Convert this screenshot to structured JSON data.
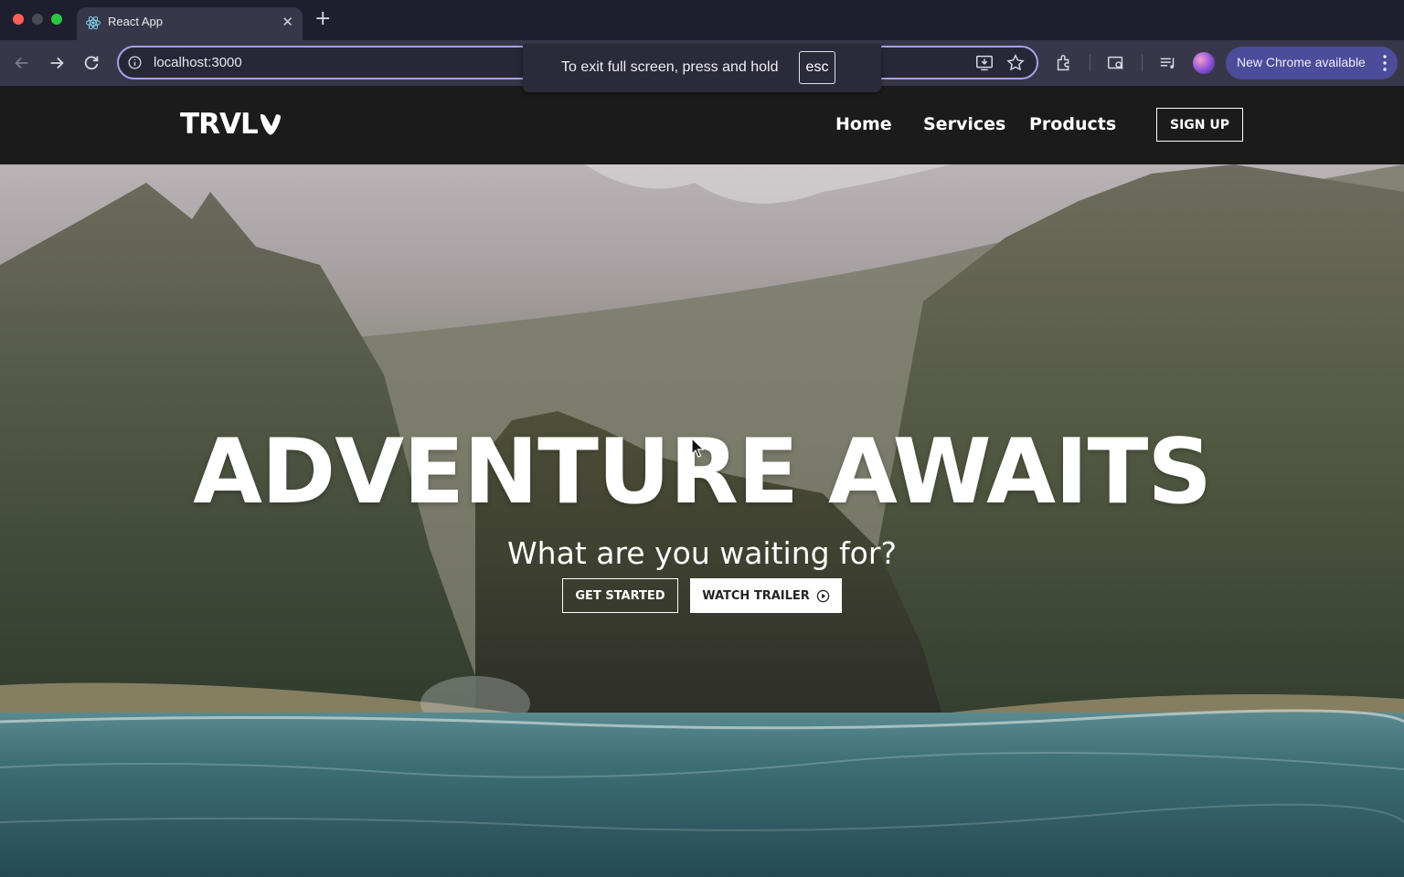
{
  "browser": {
    "tab_title": "React App",
    "tab_close": "✕",
    "new_tab": "+",
    "url": "localhost:3000",
    "update_label": "New Chrome available",
    "icons": [
      "react-favicon",
      "back-arrow-icon",
      "forward-arrow-icon",
      "reload-icon",
      "info-icon",
      "install-app-icon",
      "star-icon",
      "extensions-icon",
      "tab-search-icon",
      "media-controls-icon",
      "profile-avatar",
      "more-vert-icon"
    ]
  },
  "fullscreen_notice": {
    "text": "To exit full screen, press and hold",
    "key": "esc"
  },
  "site": {
    "logo_text": "TRVL",
    "nav": {
      "home": "Home",
      "services": "Services",
      "products": "Products",
      "signup": "SIGN UP"
    },
    "hero": {
      "title": "ADVENTURE AWAITS",
      "subtitle": "What are you waiting for?",
      "get_started": "GET STARTED",
      "watch_trailer": "WATCH TRAILER"
    }
  },
  "colors": {
    "navbar_bg": "#1b1b1b",
    "chrome_bg": "#1f1e2e",
    "toolbar_bg": "#383749",
    "omnibox_border": "#a7a1e8",
    "update_pill": "#4b4c9a"
  }
}
